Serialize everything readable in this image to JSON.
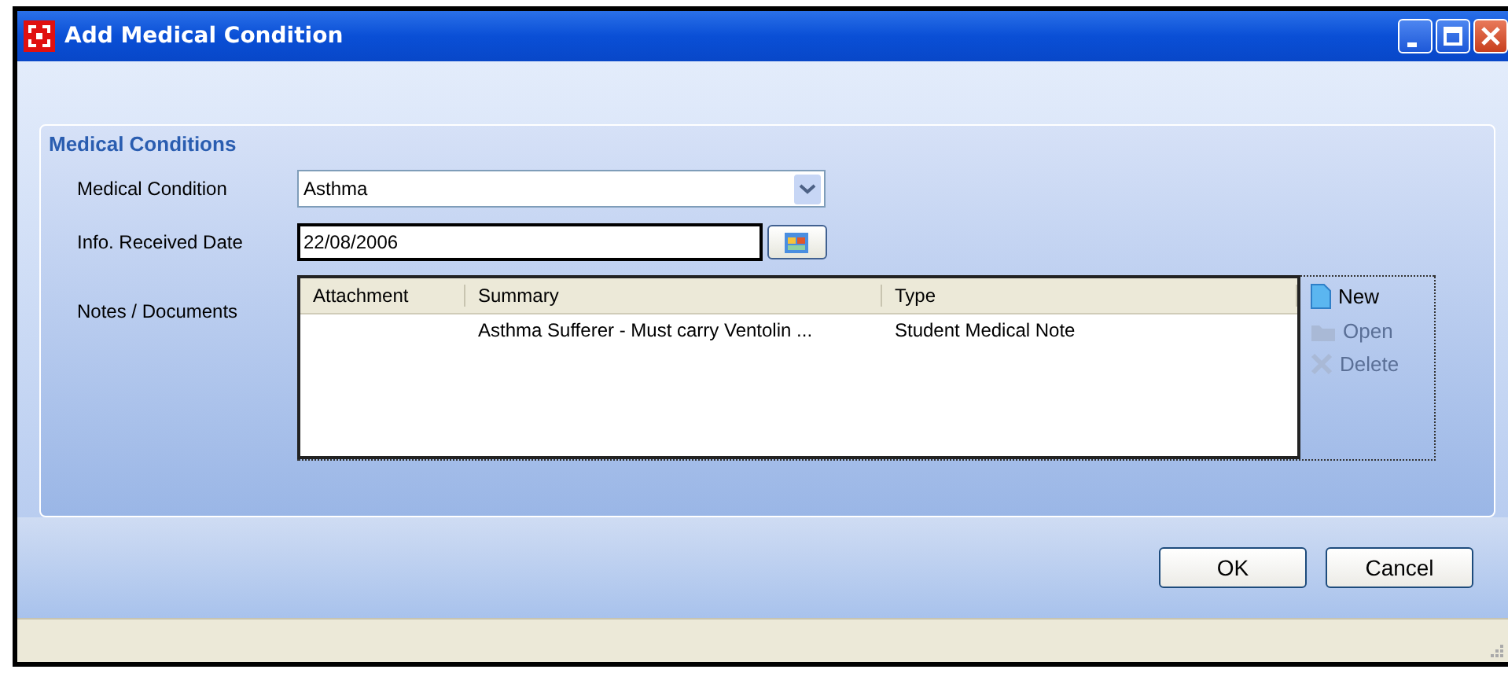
{
  "window": {
    "title": "Add Medical Condition"
  },
  "group": {
    "title": "Medical Conditions"
  },
  "fields": [
    {
      "kind": "dropdown",
      "label": "Medical Condition",
      "value": "Asthma"
    },
    {
      "kind": "date",
      "label": "Info. Received Date",
      "value": "22/08/2006"
    }
  ],
  "notes": {
    "label": "Notes / Documents",
    "table": {
      "columns": [
        "Attachment",
        "Summary",
        "Type"
      ],
      "rows": [
        [
          "",
          "Asthma Sufferer - Must carry Ventolin ...",
          "Student Medical Note"
        ]
      ]
    },
    "actions": [
      {
        "kind": "new",
        "label": "New",
        "disabled": false
      },
      {
        "kind": "open",
        "label": "Open",
        "disabled": true
      },
      {
        "kind": "delete",
        "label": "Delete",
        "disabled": true
      }
    ]
  },
  "buttons": [
    "OK",
    "Cancel"
  ]
}
